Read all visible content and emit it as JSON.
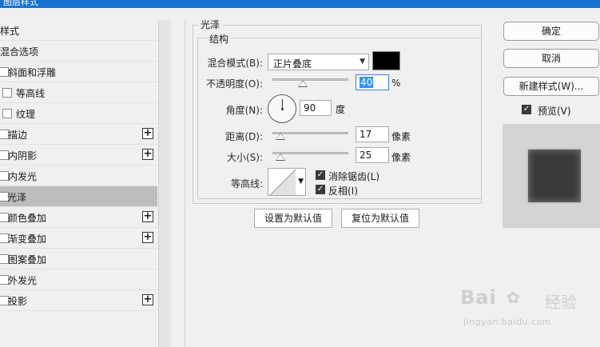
{
  "window": {
    "title": "图层样式"
  },
  "left_list": {
    "items": [
      {
        "label": "样式",
        "style": "header",
        "checkbox": false,
        "plus": false,
        "selected": false
      },
      {
        "label": "混合选项",
        "style": "header",
        "checkbox": false,
        "plus": false,
        "selected": false
      },
      {
        "label": "斜面和浮雕",
        "style": "cut",
        "checkbox": true,
        "plus": false,
        "selected": false
      },
      {
        "label": "等高线",
        "style": "indent",
        "checkbox": true,
        "plus": false,
        "selected": false
      },
      {
        "label": "纹理",
        "style": "indent",
        "checkbox": true,
        "plus": false,
        "selected": false
      },
      {
        "label": "描边",
        "style": "cut",
        "checkbox": true,
        "plus": true,
        "selected": false
      },
      {
        "label": "内阴影",
        "style": "cut",
        "checkbox": true,
        "plus": true,
        "selected": false
      },
      {
        "label": "内发光",
        "style": "cut",
        "checkbox": true,
        "plus": false,
        "selected": false
      },
      {
        "label": "光泽",
        "style": "selected",
        "checkbox": true,
        "plus": false,
        "selected": true
      },
      {
        "label": "颜色叠加",
        "style": "cut",
        "checkbox": true,
        "plus": true,
        "selected": false
      },
      {
        "label": "渐变叠加",
        "style": "cut",
        "checkbox": true,
        "plus": true,
        "selected": false
      },
      {
        "label": "图案叠加",
        "style": "cut",
        "checkbox": true,
        "plus": false,
        "selected": false
      },
      {
        "label": "外发光",
        "style": "cut",
        "checkbox": true,
        "plus": false,
        "selected": false
      },
      {
        "label": "投影",
        "style": "cut",
        "checkbox": true,
        "plus": true,
        "selected": false
      }
    ]
  },
  "satin": {
    "group_title": "光泽",
    "structure_title": "结构",
    "blend_mode": {
      "label": "混合模式(B):",
      "value": "正片叠底",
      "color": "#000000"
    },
    "opacity": {
      "label": "不透明度(O):",
      "value": "40",
      "unit": "%",
      "slider_fraction": 0.4
    },
    "angle": {
      "label": "角度(N):",
      "value": "90",
      "unit": "度"
    },
    "distance": {
      "label": "距离(D):",
      "value": "17",
      "unit": "像素",
      "slider_fraction": 0.1
    },
    "size": {
      "label": "大小(S):",
      "value": "25",
      "unit": "像素",
      "slider_fraction": 0.1
    },
    "contour": {
      "label": "等高线:"
    },
    "antialias": {
      "label": "消除锯齿(L)",
      "checked": true
    },
    "invert": {
      "label": "反相(I)",
      "checked": true
    },
    "set_default_label": "设置为默认值",
    "reset_default_label": "复位为默认值"
  },
  "right": {
    "ok_label": "确定",
    "cancel_label": "取消",
    "new_style_label": "新建样式(W)...",
    "preview": {
      "label": "预览(V)",
      "checked": true
    }
  },
  "watermark": {
    "brand": "Bai",
    "brand_suffix": "经验",
    "url": "jingyan.baidu.com"
  }
}
